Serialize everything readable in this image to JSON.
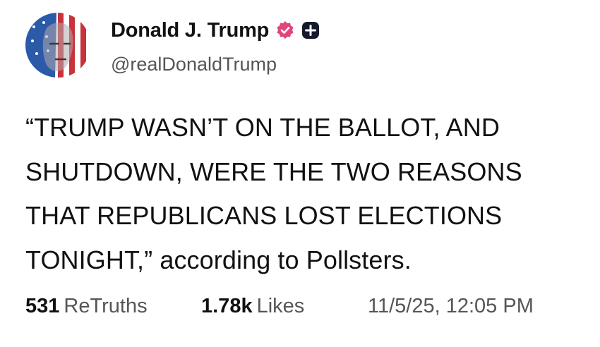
{
  "author": {
    "display_name": "Donald J. Trump",
    "handle": "@realDonaldTrump",
    "verified_icon": "verified-badge-icon",
    "plus_icon": "plus-badge-icon",
    "verified_color": "#e0457b"
  },
  "post": {
    "lines": [
      "“TRUMP WASN’T ON THE BALLOT, AND",
      "SHUTDOWN, WERE THE TWO REASONS",
      "THAT REPUBLICANS LOST ELECTIONS",
      "TONIGHT,” according to Pollsters."
    ]
  },
  "stats": {
    "retruths_count": "531",
    "retruths_label": "ReTruths",
    "likes_count": "1.78k",
    "likes_label": "Likes",
    "timestamp": "11/5/25, 12:05 PM"
  }
}
